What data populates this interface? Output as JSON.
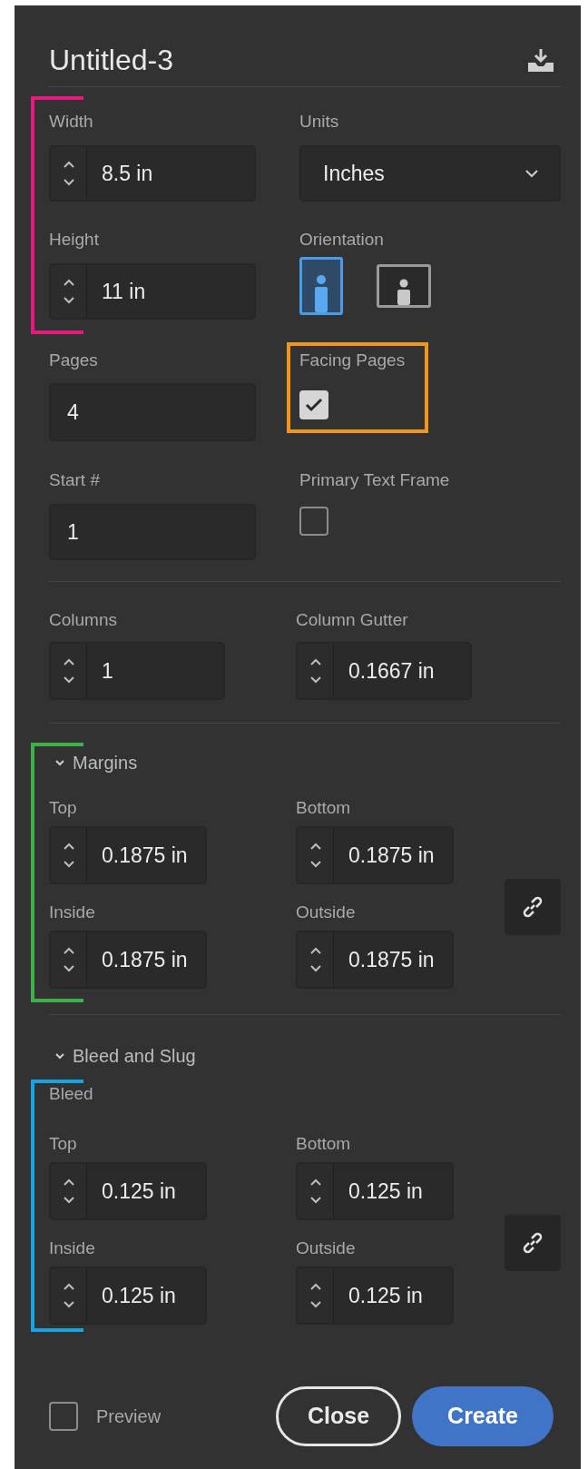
{
  "title": "Untitled-3",
  "width": {
    "label": "Width",
    "value": "8.5 in"
  },
  "units": {
    "label": "Units",
    "value": "Inches"
  },
  "height": {
    "label": "Height",
    "value": "11 in"
  },
  "orientation": {
    "label": "Orientation",
    "options": [
      {
        "kind": "portrait",
        "selected": true
      },
      {
        "kind": "landscape",
        "selected": false
      }
    ]
  },
  "pages": {
    "label": "Pages",
    "value": "4"
  },
  "facing_pages": {
    "label": "Facing Pages",
    "checked": true
  },
  "start": {
    "label": "Start #",
    "value": "1"
  },
  "primary_text_frame": {
    "label": "Primary Text Frame",
    "checked": false
  },
  "columns": {
    "label": "Columns",
    "value": "1"
  },
  "column_gutter": {
    "label": "Column Gutter",
    "value": "0.1667 in"
  },
  "margins": {
    "title": "Margins",
    "expanded": true,
    "fields": [
      {
        "label": "Top",
        "value": "0.1875 in"
      },
      {
        "label": "Bottom",
        "value": "0.1875 in"
      },
      {
        "label": "Inside",
        "value": "0.1875 in"
      },
      {
        "label": "Outside",
        "value": "0.1875 in"
      }
    ]
  },
  "bleed_and_slug": {
    "title": "Bleed and Slug",
    "expanded": true,
    "subtitle": "Bleed",
    "fields": [
      {
        "label": "Top",
        "value": "0.125 in"
      },
      {
        "label": "Bottom",
        "value": "0.125 in"
      },
      {
        "label": "Inside",
        "value": "0.125 in"
      },
      {
        "label": "Outside",
        "value": "0.125 in"
      }
    ]
  },
  "preview": {
    "label": "Preview",
    "checked": false
  },
  "buttons": [
    {
      "label": "Close",
      "kind": "secondary"
    },
    {
      "label": "Create",
      "kind": "primary"
    }
  ]
}
